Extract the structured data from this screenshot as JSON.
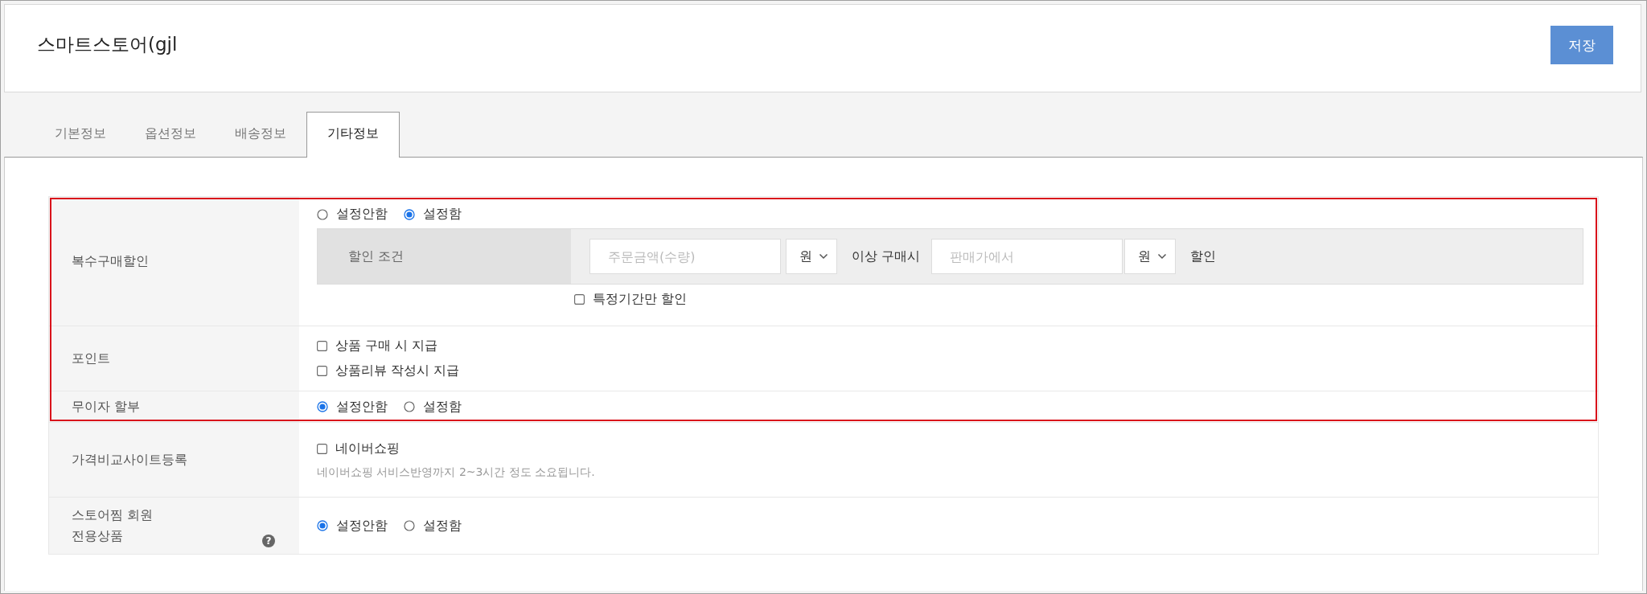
{
  "header": {
    "title": "스마트스토어(gjl",
    "save_button": "저장"
  },
  "tabs": [
    {
      "label": "기본정보",
      "selected": false
    },
    {
      "label": "옵션정보",
      "selected": false
    },
    {
      "label": "배송정보",
      "selected": false
    },
    {
      "label": "기타정보",
      "selected": true
    }
  ],
  "rows": [
    {
      "kind": "discount",
      "label": "복수구매할인",
      "highlighted": true,
      "options": [
        {
          "label": "설정안함",
          "selected": false
        },
        {
          "label": "설정함",
          "selected": true
        }
      ],
      "condition": {
        "label": "할인 조건",
        "amount_placeholder": "주문금액(수량)",
        "amount_unit": "원",
        "between": "이상 구매시",
        "price_placeholder": "판매가에서",
        "price_unit": "원",
        "suffix": "할인"
      },
      "period": {
        "label": "특정기간만 할인",
        "checked": false
      }
    },
    {
      "kind": "checks",
      "label": "포인트",
      "highlighted": true,
      "checks": [
        {
          "label": "상품 구매 시 지급",
          "checked": false
        },
        {
          "label": "상품리뷰 작성시 지급",
          "checked": false
        }
      ]
    },
    {
      "kind": "radios",
      "label": "무이자 할부",
      "highlighted": true,
      "options": [
        {
          "label": "설정안함",
          "selected": true
        },
        {
          "label": "설정함",
          "selected": false
        }
      ]
    },
    {
      "kind": "checks",
      "label": "가격비교사이트등록",
      "highlighted": false,
      "checks": [
        {
          "label": "네이버쇼핑",
          "checked": false
        }
      ],
      "note": "네이버쇼핑 서비스반영까지 2~3시간 정도 소요됩니다."
    },
    {
      "kind": "radios",
      "label": "스토어찜 회원\n전용상품",
      "help": "?",
      "highlighted": false,
      "options": [
        {
          "label": "설정안함",
          "selected": true
        },
        {
          "label": "설정함",
          "selected": false
        }
      ]
    }
  ]
}
